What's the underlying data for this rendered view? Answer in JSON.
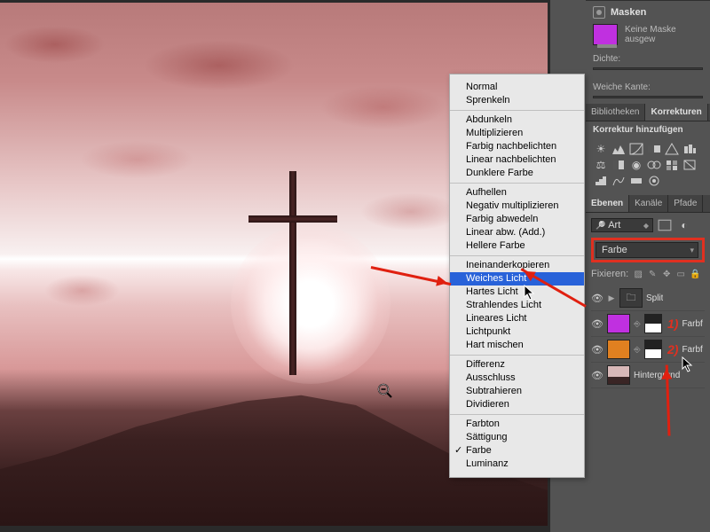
{
  "masks_panel": {
    "title": "Masken",
    "no_mask": "Keine Maske ausgew",
    "density_label": "Dichte:",
    "feather_label": "Weiche Kante:"
  },
  "library_tabs": {
    "lib": "Bibliotheken",
    "adj": "Korrekturen"
  },
  "adjustments_title": "Korrektur hinzufügen",
  "layers_tabs": {
    "layers": "Ebenen",
    "channels": "Kanäle",
    "paths": "Pfade"
  },
  "layers_panel": {
    "type_label": "Art",
    "blend_value": "Farbe",
    "lock_label": "Fixieren:"
  },
  "layers": {
    "group": "Split",
    "l1": "Farbf",
    "l2": "Farbf",
    "bg": "Hintergrund",
    "n1": "1)",
    "n2": "2)"
  },
  "blend_modes": {
    "g1": {
      "normal": "Normal",
      "dissolve": "Sprenkeln"
    },
    "g2": {
      "darken": "Abdunkeln",
      "multiply": "Multiplizieren",
      "colorburn": "Farbig nachbelichten",
      "linearburn": "Linear nachbelichten",
      "darkercolor": "Dunklere Farbe"
    },
    "g3": {
      "lighten": "Aufhellen",
      "screen": "Negativ multiplizieren",
      "colordodge": "Farbig abwedeln",
      "lineardodge": "Linear abw. (Add.)",
      "lightercolor": "Hellere Farbe"
    },
    "g4": {
      "overlay": "Ineinanderkopieren",
      "softlight": "Weiches Licht",
      "hardlight": "Hartes Licht",
      "vividlight": "Strahlendes Licht",
      "linearlight": "Lineares Licht",
      "pinlight": "Lichtpunkt",
      "hardmix": "Hart mischen"
    },
    "g5": {
      "difference": "Differenz",
      "exclusion": "Ausschluss",
      "subtract": "Subtrahieren",
      "divide": "Dividieren"
    },
    "g6": {
      "hue": "Farbton",
      "saturation": "Sättigung",
      "color": "Farbe",
      "luminosity": "Luminanz"
    }
  }
}
